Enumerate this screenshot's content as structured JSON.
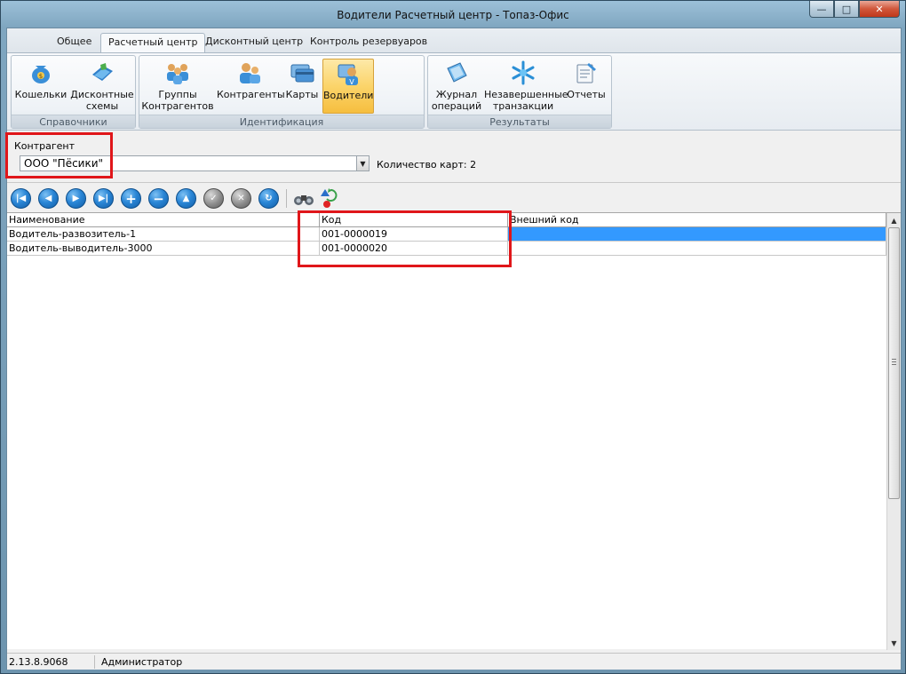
{
  "window": {
    "title": "Водители Расчетный центр - Топаз-Офис"
  },
  "ribbon_tabs": [
    {
      "label": "Общее"
    },
    {
      "label": "Расчетный центр",
      "active": true
    },
    {
      "label": "Дисконтный центр"
    },
    {
      "label": "Контроль резервуаров"
    }
  ],
  "groups": {
    "reference": {
      "label": "Справочники",
      "buttons": [
        {
          "label": "Кошельки",
          "icon": "wallet-icon"
        },
        {
          "label": "Дисконтные схемы",
          "icon": "discount-schemes-icon"
        }
      ]
    },
    "identification": {
      "label": "Идентификация",
      "buttons": [
        {
          "label": "Группы Контрагентов",
          "icon": "contractor-groups-icon"
        },
        {
          "label": "Контрагенты",
          "icon": "contractors-icon"
        },
        {
          "label": "Карты",
          "icon": "cards-icon"
        },
        {
          "label": "Водители",
          "icon": "drivers-icon",
          "active": true
        }
      ]
    },
    "results": {
      "label": "Результаты",
      "buttons": [
        {
          "label": "Журнал операций",
          "icon": "journal-icon"
        },
        {
          "label": "Незавершенные транзакции",
          "icon": "pending-transactions-icon"
        },
        {
          "label": "Отчеты",
          "icon": "reports-icon"
        }
      ]
    }
  },
  "filter": {
    "label": "Контрагент",
    "value": "ООО \"Пёсики\"",
    "card_count": "Количество карт: 2"
  },
  "grid": {
    "columns": [
      "Наименование",
      "Код",
      "Внешний код"
    ],
    "rows": [
      [
        "Водитель-развозитель-1",
        "001-0000019",
        ""
      ],
      [
        "Водитель-выводитель-3000",
        "001-0000020",
        ""
      ]
    ]
  },
  "status": {
    "version": "2.13.8.9068",
    "user": "Администратор"
  },
  "colors": {
    "highlight": "#3399ff",
    "annotation": "#e0161a",
    "active_button": "#fbd46a"
  }
}
